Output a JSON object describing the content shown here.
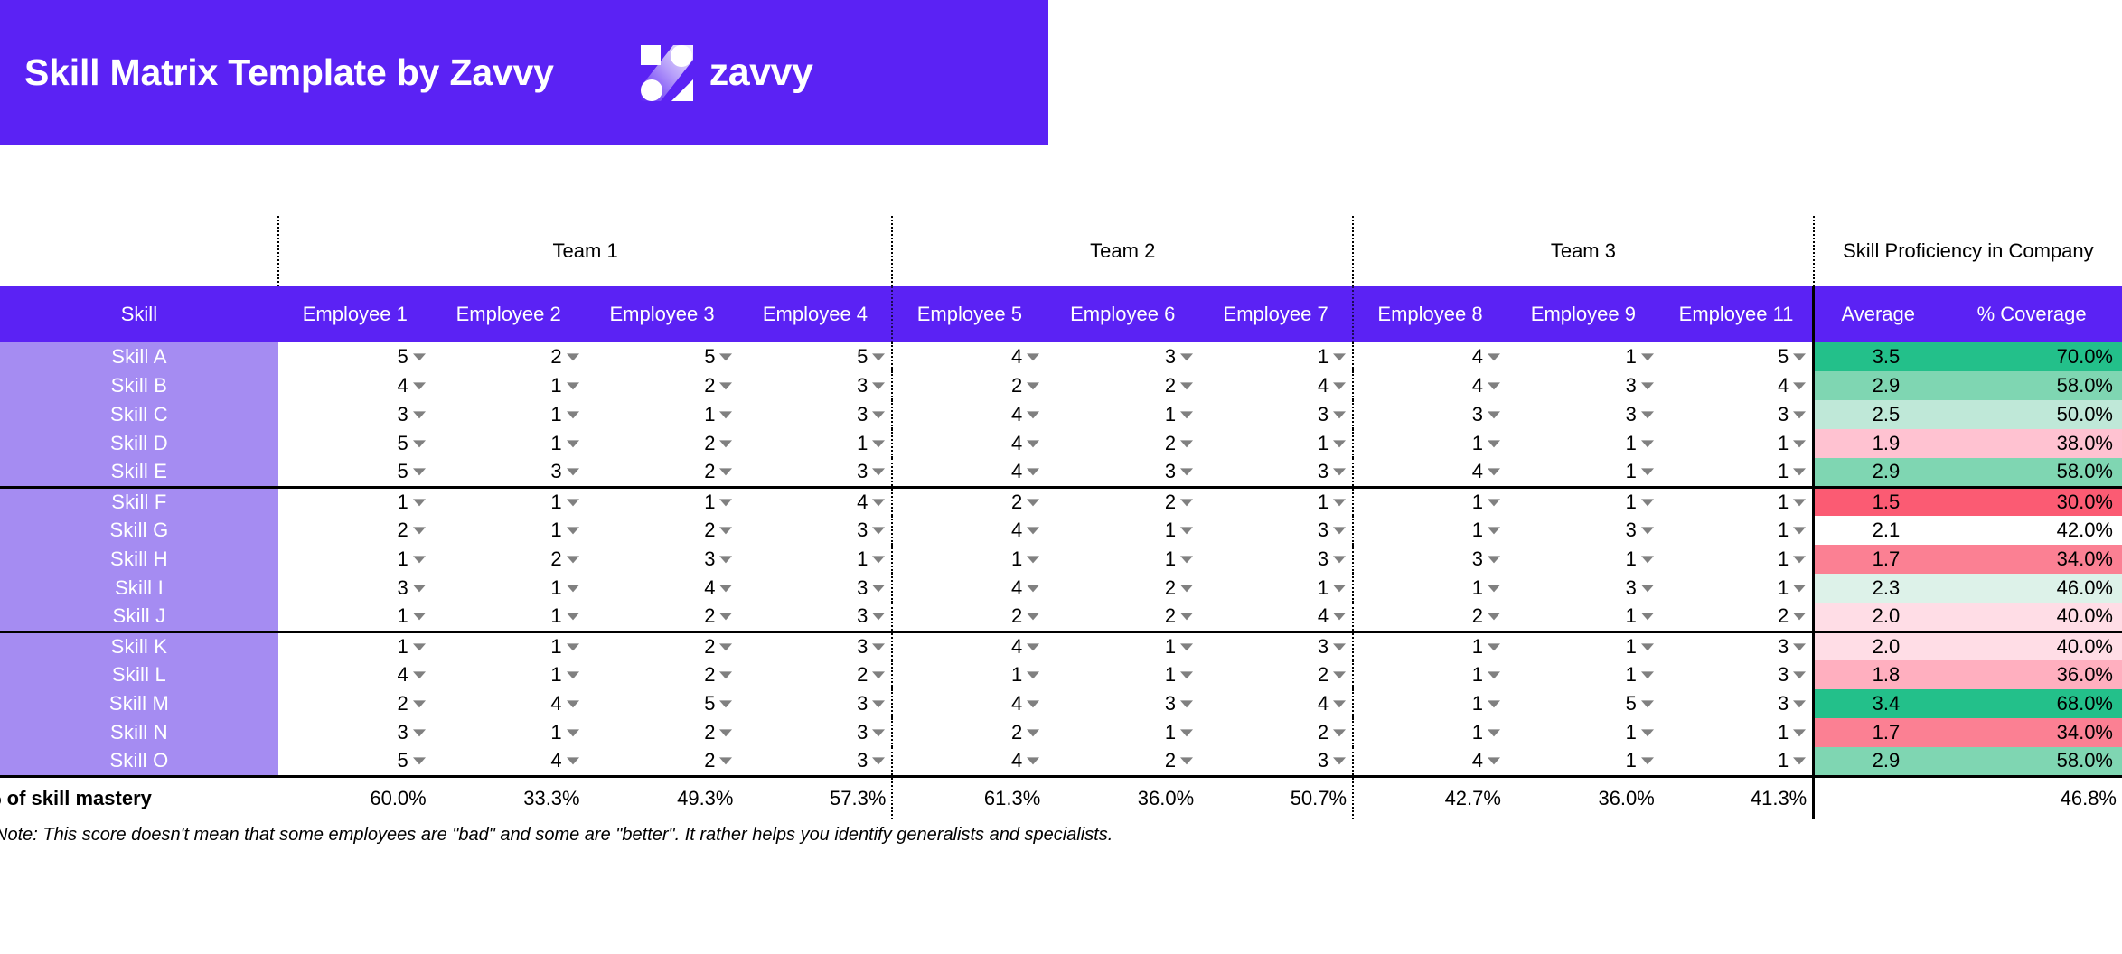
{
  "banner": {
    "title": "Skill Matrix Template by Zavvy",
    "brand_word": "zavvy",
    "brand_mark_icon": "zavvy-z-logo-icon",
    "bg_color": "#5B22F4"
  },
  "teams": [
    {
      "label": "",
      "span": 1
    },
    {
      "label": "Team 1",
      "span": 4
    },
    {
      "label": "Team 2",
      "span": 3
    },
    {
      "label": "Team 3",
      "span": 3
    },
    {
      "label": "Skill Proficiency in Company",
      "span": 2
    }
  ],
  "columns": {
    "skill": "Skill",
    "employees": [
      "Employee 1",
      "Employee 2",
      "Employee 3",
      "Employee 4",
      "Employee 5",
      "Employee 6",
      "Employee 7",
      "Employee 8",
      "Employee 9",
      "Employee 11"
    ],
    "average": "Average",
    "coverage": "% Coverage"
  },
  "rows": [
    {
      "skill": "Skill A",
      "values": [
        5,
        2,
        5,
        5,
        4,
        3,
        1,
        4,
        1,
        5
      ],
      "average": "3.5",
      "coverage": "70.0%",
      "avg_color": "#23C08A",
      "cov_color": "#23C08A"
    },
    {
      "skill": "Skill B",
      "values": [
        4,
        1,
        2,
        3,
        2,
        2,
        4,
        4,
        3,
        4
      ],
      "average": "2.9",
      "coverage": "58.0%",
      "avg_color": "#7FD6B2",
      "cov_color": "#7FD6B2"
    },
    {
      "skill": "Skill C",
      "values": [
        3,
        1,
        1,
        3,
        4,
        1,
        3,
        3,
        3,
        3
      ],
      "average": "2.5",
      "coverage": "50.0%",
      "avg_color": "#BFE8D8",
      "cov_color": "#BFE8D8"
    },
    {
      "skill": "Skill D",
      "values": [
        5,
        1,
        2,
        1,
        4,
        2,
        1,
        1,
        1,
        1
      ],
      "average": "1.9",
      "coverage": "38.0%",
      "avg_color": "#FFC2D1",
      "cov_color": "#FFC2D1"
    },
    {
      "skill": "Skill E",
      "values": [
        5,
        3,
        2,
        3,
        4,
        3,
        3,
        4,
        1,
        1
      ],
      "average": "2.9",
      "coverage": "58.0%",
      "avg_color": "#7FD6B2",
      "cov_color": "#7FD6B2"
    },
    {
      "skill": "Skill F",
      "values": [
        1,
        1,
        1,
        4,
        2,
        2,
        1,
        1,
        1,
        1
      ],
      "average": "1.5",
      "coverage": "30.0%",
      "avg_color": "#FB5B73",
      "cov_color": "#FB5B73"
    },
    {
      "skill": "Skill G",
      "values": [
        2,
        1,
        2,
        3,
        4,
        1,
        3,
        1,
        3,
        1
      ],
      "average": "2.1",
      "coverage": "42.0%",
      "avg_color": "#FFFFFF",
      "cov_color": "#FFFFFF"
    },
    {
      "skill": "Skill H",
      "values": [
        1,
        2,
        3,
        1,
        1,
        1,
        3,
        3,
        1,
        1
      ],
      "average": "1.7",
      "coverage": "34.0%",
      "avg_color": "#FB8093",
      "cov_color": "#FB8093"
    },
    {
      "skill": "Skill I",
      "values": [
        3,
        1,
        4,
        3,
        4,
        2,
        1,
        1,
        3,
        1
      ],
      "average": "2.3",
      "coverage": "46.0%",
      "avg_color": "#DDF2E9",
      "cov_color": "#DDF2E9"
    },
    {
      "skill": "Skill J",
      "values": [
        1,
        1,
        2,
        3,
        2,
        2,
        4,
        2,
        1,
        2
      ],
      "average": "2.0",
      "coverage": "40.0%",
      "avg_color": "#FFDDE6",
      "cov_color": "#FFDDE6"
    },
    {
      "skill": "Skill K",
      "values": [
        1,
        1,
        2,
        3,
        4,
        1,
        3,
        1,
        1,
        3
      ],
      "average": "2.0",
      "coverage": "40.0%",
      "avg_color": "#FFDDE6",
      "cov_color": "#FFDDE6"
    },
    {
      "skill": "Skill L",
      "values": [
        4,
        1,
        2,
        2,
        1,
        1,
        2,
        1,
        1,
        3
      ],
      "average": "1.8",
      "coverage": "36.0%",
      "avg_color": "#FFAFBF",
      "cov_color": "#FFAFBF"
    },
    {
      "skill": "Skill M",
      "values": [
        2,
        4,
        5,
        3,
        4,
        3,
        4,
        1,
        5,
        3
      ],
      "average": "3.4",
      "coverage": "68.0%",
      "avg_color": "#23C08A",
      "cov_color": "#23C08A"
    },
    {
      "skill": "Skill N",
      "values": [
        3,
        1,
        2,
        3,
        2,
        1,
        2,
        1,
        1,
        1
      ],
      "average": "1.7",
      "coverage": "34.0%",
      "avg_color": "#FB8093",
      "cov_color": "#FB8093"
    },
    {
      "skill": "Skill O",
      "values": [
        5,
        4,
        2,
        3,
        4,
        2,
        3,
        4,
        1,
        1
      ],
      "average": "2.9",
      "coverage": "58.0%",
      "avg_color": "#7FD6B2",
      "cov_color": "#7FD6B2"
    }
  ],
  "footer": {
    "label": "% of skill mastery",
    "values": [
      "60.0%",
      "33.3%",
      "49.3%",
      "57.3%",
      "61.3%",
      "36.0%",
      "50.7%",
      "42.7%",
      "36.0%",
      "41.3%"
    ],
    "average_cell": "",
    "coverage_cell": "46.8%",
    "note": "Note: This score doesn't mean that some employees are \"bad\" and some are \"better\". It rather helps you identify generalists and specialists."
  },
  "caret_icon": "chevron-down-icon"
}
